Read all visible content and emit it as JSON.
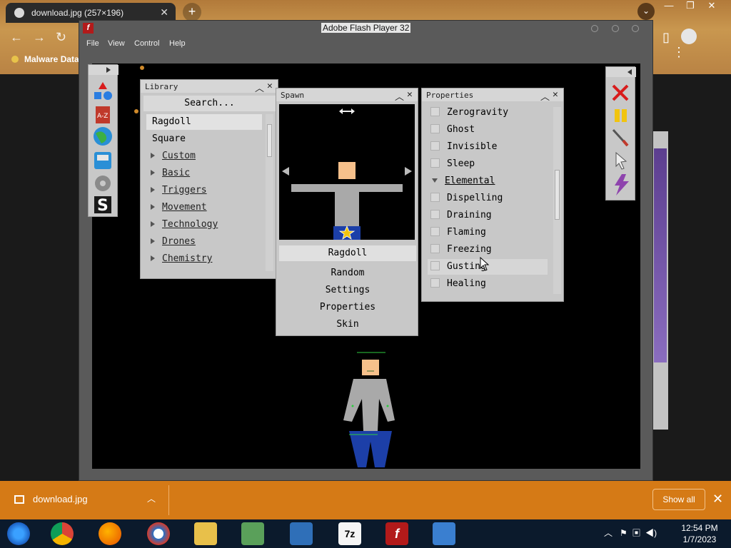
{
  "browser": {
    "tab_title": "download.jpg (257×196)",
    "bookmark": "Malware Data"
  },
  "flash": {
    "title": "Adobe Flash Player 32",
    "menu": [
      "File",
      "View",
      "Control",
      "Help"
    ]
  },
  "library": {
    "title": "Library",
    "search": "Search...",
    "items": [
      "Ragdoll",
      "Square"
    ],
    "categories": [
      "Custom",
      "Basic",
      "Triggers",
      "Movement",
      "Technology",
      "Drones",
      "Chemistry"
    ]
  },
  "spawn": {
    "title": "Spawn",
    "options": [
      "Ragdoll",
      "Random",
      "Settings",
      "Properties",
      "Skin"
    ]
  },
  "properties": {
    "title": "Properties",
    "items": [
      "Zerogravity",
      "Ghost",
      "Invisible",
      "Sleep"
    ],
    "group": "Elemental",
    "group_items": [
      "Dispelling",
      "Draining",
      "Flaming",
      "Freezing",
      "Gusting",
      "Healing"
    ]
  },
  "downloads": {
    "file": "download.jpg",
    "show_all": "Show all"
  },
  "taskbar": {
    "time": "12:54 PM",
    "date": "1/7/2023"
  },
  "colors": {
    "download_bar": "#d57a16",
    "stage": "#000000",
    "panel": "#c8c8c8"
  }
}
